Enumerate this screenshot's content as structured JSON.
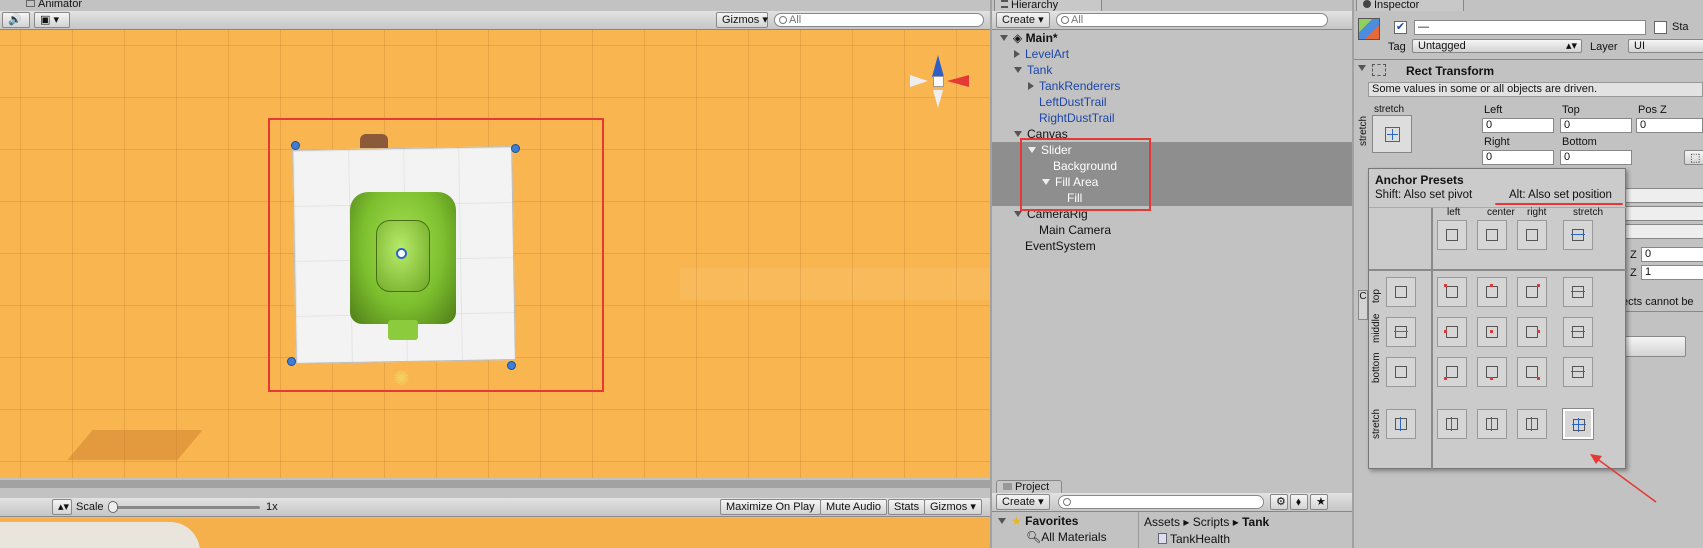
{
  "animator": {
    "tab": "Animator"
  },
  "scene": {
    "gizmos_label": "Gizmos",
    "search_placeholder": "All"
  },
  "game": {
    "scale_label": "Scale",
    "scale_value": "1x",
    "scale_fraction": 0,
    "buttons": [
      "Maximize On Play",
      "Mute Audio",
      "Stats",
      "Gizmos"
    ]
  },
  "hierarchy": {
    "tab": "Hierarchy",
    "create_label": "Create",
    "search_placeholder": "All",
    "items": [
      {
        "label": "Main*",
        "depth": 0,
        "expand": "down",
        "color": "black",
        "bold": true,
        "unity_icon": true
      },
      {
        "label": "LevelArt",
        "depth": 1,
        "expand": "right",
        "color": "blue"
      },
      {
        "label": "Tank",
        "depth": 1,
        "expand": "down",
        "color": "blue"
      },
      {
        "label": "TankRenderers",
        "depth": 2,
        "expand": "right",
        "color": "blue"
      },
      {
        "label": "LeftDustTrail",
        "depth": 2,
        "expand": "none",
        "color": "blue"
      },
      {
        "label": "RightDustTrail",
        "depth": 2,
        "expand": "none",
        "color": "blue"
      },
      {
        "label": "Canvas",
        "depth": 1,
        "expand": "down",
        "color": "black"
      },
      {
        "label": "Slider",
        "depth": 2,
        "expand": "down",
        "color": "white",
        "selected": true
      },
      {
        "label": "Background",
        "depth": 3,
        "expand": "none",
        "color": "white",
        "selected": true
      },
      {
        "label": "Fill Area",
        "depth": 3,
        "expand": "down",
        "color": "white",
        "selected": true
      },
      {
        "label": "Fill",
        "depth": 4,
        "expand": "none",
        "color": "white",
        "selected": true
      },
      {
        "label": "CameraRig",
        "depth": 1,
        "expand": "down",
        "color": "black"
      },
      {
        "label": "Main Camera",
        "depth": 2,
        "expand": "none",
        "color": "black"
      },
      {
        "label": "EventSystem",
        "depth": 1,
        "expand": "none",
        "color": "black"
      }
    ]
  },
  "project": {
    "tab": "Project",
    "create_label": "Create",
    "favorites": "Favorites",
    "favorite_items": [
      "All Materials"
    ],
    "breadcrumb": [
      "Assets",
      "Scripts",
      "Tank"
    ],
    "files": [
      "TankHealth"
    ]
  },
  "inspector": {
    "tab": "Inspector",
    "name_value": "—",
    "static_label": "Sta",
    "tag_label": "Tag",
    "tag_value": "Untagged",
    "layer_label": "Layer",
    "layer_value": "UI",
    "rect_transform_title": "Rect Transform",
    "driven_note": "Some values in some or all objects are driven.",
    "anchor_label": "stretch",
    "side_label": "stretch",
    "fields": {
      "left": {
        "label": "Left",
        "value": "0"
      },
      "top": {
        "label": "Top",
        "value": "0"
      },
      "posz": {
        "label": "Pos Z",
        "value": "0"
      },
      "right": {
        "label": "Right",
        "value": "0"
      },
      "bottom": {
        "label": "Bottom",
        "value": "0"
      }
    },
    "z_labels": [
      "Z",
      "Z"
    ],
    "z_values": [
      "0",
      "1"
    ],
    "truncated_note": "ects cannot be",
    "side_clip": "C"
  },
  "anchor_presets": {
    "title": "Anchor Presets",
    "shift_hint": "Shift: Also set pivot",
    "alt_hint": "Alt: Also set position",
    "col_labels": [
      "left",
      "center",
      "right",
      "stretch"
    ],
    "row_labels": [
      "top",
      "middle",
      "bottom",
      "stretch"
    ]
  },
  "colors": {
    "scene_bg": "#f9b54f",
    "selection_red": "#e53935",
    "hierarchy_selected": "#8e8e8e",
    "link_blue": "#1d46a8",
    "anchor_blue": "#2a66c8",
    "tank_green": "#7cbf2e"
  }
}
